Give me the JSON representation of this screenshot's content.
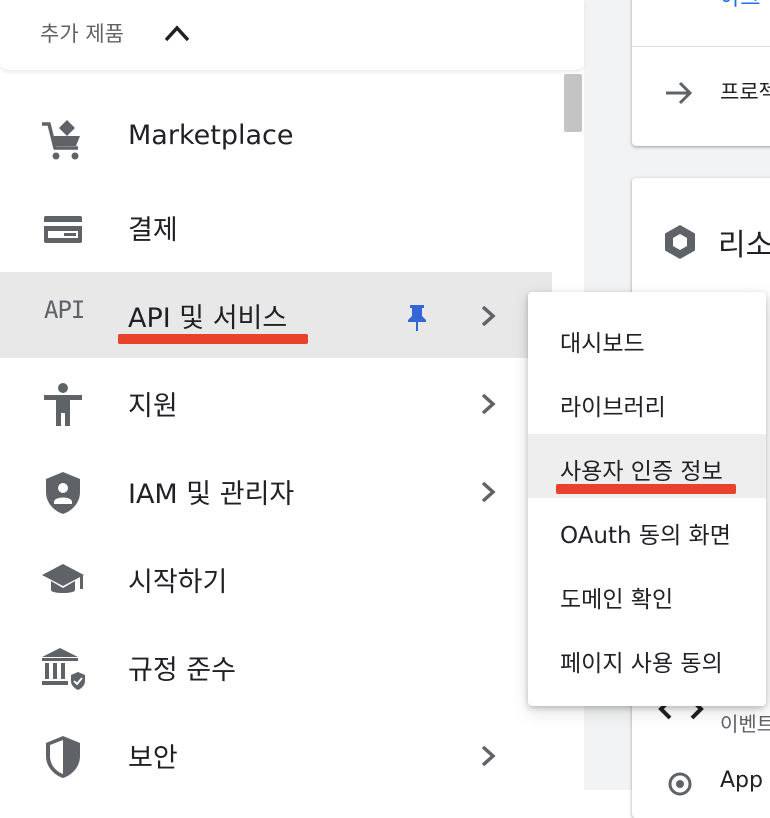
{
  "background": {
    "top_link": "아크",
    "project_label": "프로젝",
    "resource_title": "리소",
    "event_label": "이벤트",
    "app_label": "App"
  },
  "nav": {
    "header": "추가 제품",
    "items": [
      {
        "label": "Marketplace"
      },
      {
        "label": "결제"
      },
      {
        "label": "API 및 서비스",
        "icon_text": "API"
      },
      {
        "label": "지원"
      },
      {
        "label": "IAM 및 관리자"
      },
      {
        "label": "시작하기"
      },
      {
        "label": "규정 준수"
      },
      {
        "label": "보안"
      }
    ]
  },
  "submenu": {
    "items": [
      {
        "label": "대시보드"
      },
      {
        "label": "라이브러리"
      },
      {
        "label": "사용자 인증 정보"
      },
      {
        "label": "OAuth 동의 화면"
      },
      {
        "label": "도메인 확인"
      },
      {
        "label": "페이지 사용 동의"
      }
    ]
  },
  "colors": {
    "annotation_underline": "#e8412c",
    "pin": "#3367d6",
    "active_bg": "#e8e8e8",
    "link": "#1a73e8"
  }
}
